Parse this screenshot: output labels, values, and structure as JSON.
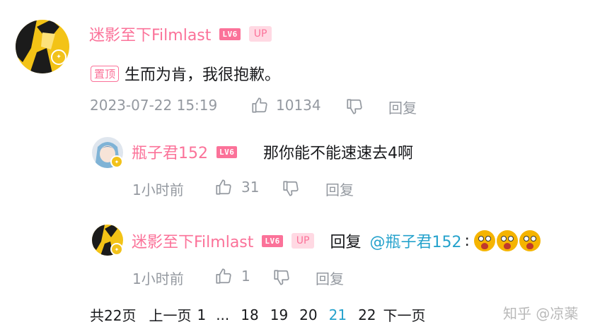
{
  "comment": {
    "username": "迷影至下Filmlast",
    "level": "LV6",
    "up_badge": "UP",
    "pinned_label": "置顶",
    "text": "生而为肯，我很抱歉。",
    "timestamp": "2023-07-22 15:19",
    "likes": "10134",
    "reply_label": "回复"
  },
  "replies": [
    {
      "username": "瓶子君152",
      "level": "LV6",
      "text": "那你能不能速速去4啊",
      "time": "1小时前",
      "likes": "31",
      "reply_label": "回复"
    },
    {
      "username": "迷影至下Filmlast",
      "level": "LV6",
      "up_badge": "UP",
      "reply_prefix": "回复",
      "mention": "@瓶子君152",
      "colon": ":",
      "emoji_names": [
        "shocked-face-emoji",
        "shocked-face-emoji",
        "shocked-face-emoji"
      ],
      "time": "1小时前",
      "likes": "1",
      "reply_label": "回复"
    }
  ],
  "pagination": {
    "total": "共22页",
    "prev": "上一页",
    "pages": [
      "1",
      "...",
      "18",
      "19",
      "20",
      "21",
      "22"
    ],
    "current": "21",
    "next": "下一页"
  },
  "watermark": "知乎 @凉薬",
  "colors": {
    "username": "#fb7299",
    "link": "#25a2cc",
    "meta": "#9499a0",
    "badge_gold": "#f2c21a"
  }
}
